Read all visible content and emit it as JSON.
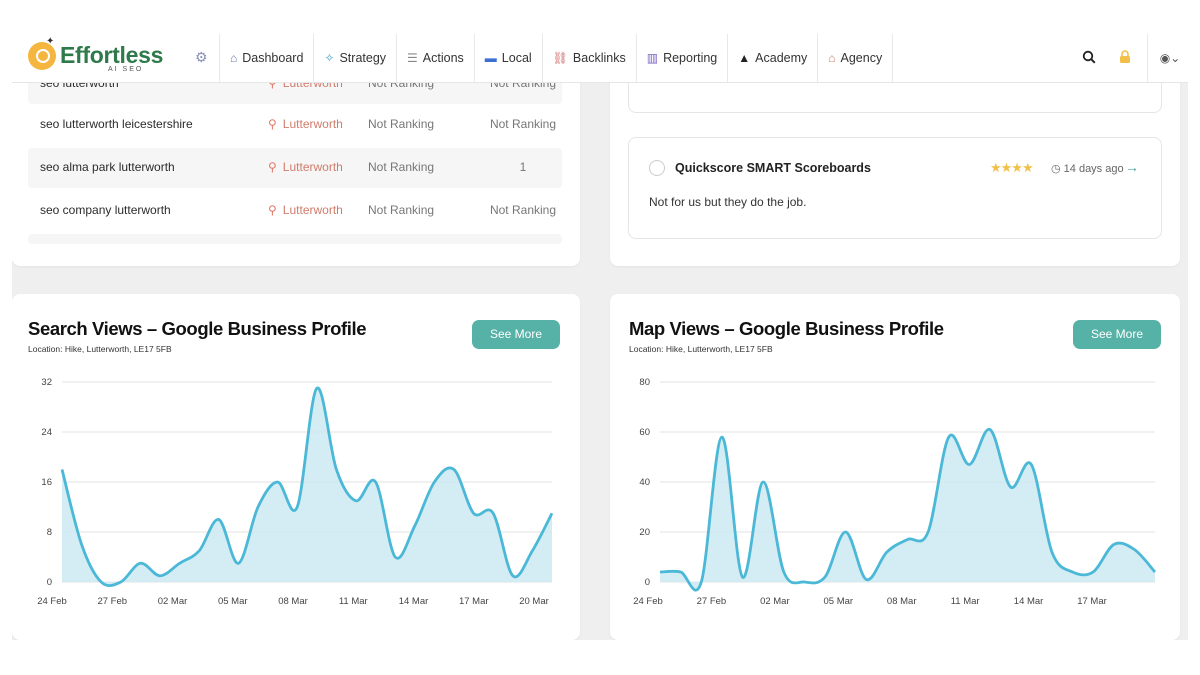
{
  "nav": {
    "logo_text": "Effortless",
    "logo_sub": "AI SEO",
    "items": [
      {
        "label": "Dashboard",
        "icon": "home-icon"
      },
      {
        "label": "Strategy",
        "icon": "strategy-icon"
      },
      {
        "label": "Actions",
        "icon": "checklist-icon"
      },
      {
        "label": "Local",
        "icon": "store-icon"
      },
      {
        "label": "Backlinks",
        "icon": "link-icon"
      },
      {
        "label": "Reporting",
        "icon": "bar-chart-icon"
      },
      {
        "label": "Academy",
        "icon": "graduation-cap-icon"
      },
      {
        "label": "Agency",
        "icon": "agency-icon"
      }
    ],
    "right_icons": [
      "search-icon",
      "lock-icon",
      "user-avatar-icon"
    ]
  },
  "keywords": {
    "rows": [
      {
        "keyword": "seo lutterworth",
        "location": "Lutterworth",
        "rank1": "Not Ranking",
        "rank2": "Not Ranking"
      },
      {
        "keyword": "seo lutterworth leicestershire",
        "location": "Lutterworth",
        "rank1": "Not Ranking",
        "rank2": "Not Ranking"
      },
      {
        "keyword": "seo alma park lutterworth",
        "location": "Lutterworth",
        "rank1": "Not Ranking",
        "rank2": "1"
      },
      {
        "keyword": "seo company lutterworth",
        "location": "Lutterworth",
        "rank1": "Not Ranking",
        "rank2": "Not Ranking"
      }
    ]
  },
  "review": {
    "source": "Quickscore SMART Scoreboards",
    "stars": "★★★★",
    "rating": 4,
    "age": "14 days ago",
    "text": "Not for us but they do the job."
  },
  "search_views": {
    "title": "Search Views – Google Business Profile",
    "location": "Location: Hike, Lutterworth, LE17 5FB",
    "button": "See More"
  },
  "map_views": {
    "title": "Map Views – Google Business Profile",
    "location": "Location: Hike, Lutterworth, LE17 5FB",
    "button": "See More"
  },
  "colors": {
    "accent": "#56b1a6",
    "line": "#4ab8d6",
    "fill": "#cdeaf3",
    "location": "#d07c6c",
    "star": "#f2c04a"
  },
  "chart_data": [
    {
      "type": "area",
      "title": "Search Views – Google Business Profile",
      "x_ticks": [
        "24 Feb",
        "27 Feb",
        "02 Mar",
        "05 Mar",
        "08 Mar",
        "11 Mar",
        "14 Mar",
        "17 Mar",
        "20 Mar"
      ],
      "y_ticks": [
        0,
        8,
        16,
        24,
        32
      ],
      "ylim": [
        0,
        32
      ],
      "grid": true,
      "series": [
        {
          "values": [
            18,
            6,
            0,
            0,
            3,
            1,
            3,
            5,
            10,
            3,
            12,
            16,
            12,
            31,
            18,
            13,
            16,
            4,
            9,
            16,
            18,
            11,
            11,
            1,
            5,
            11
          ]
        }
      ]
    },
    {
      "type": "area",
      "title": "Map Views – Google Business Profile",
      "x_ticks": [
        "24 Feb",
        "27 Feb",
        "02 Mar",
        "05 Mar",
        "08 Mar",
        "11 Mar",
        "14 Mar",
        "17 Mar"
      ],
      "y_ticks": [
        0,
        20,
        40,
        60,
        80
      ],
      "ylim": [
        0,
        80
      ],
      "grid": true,
      "series": [
        {
          "values": [
            4,
            4,
            0,
            58,
            2,
            40,
            4,
            0,
            2,
            20,
            1,
            12,
            17,
            20,
            58,
            47,
            61,
            38,
            47,
            12,
            4,
            4,
            15,
            13,
            4
          ]
        }
      ]
    }
  ]
}
